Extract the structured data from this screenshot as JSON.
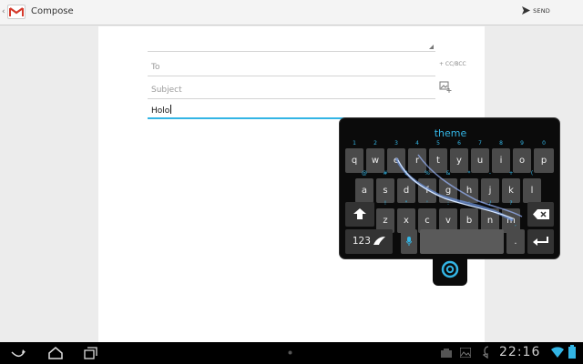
{
  "app": {
    "title": "Compose",
    "send_label": "SEND",
    "accent": "#33b5e5",
    "back_glyph": "‹"
  },
  "form": {
    "to_placeholder": "To",
    "cc_bcc_label": "+ CC/BCC",
    "subject_placeholder": "Subject",
    "body_value": "Holo"
  },
  "keyboard": {
    "theme_label": "theme",
    "row1": [
      "q",
      "w",
      "e",
      "r",
      "t",
      "y",
      "u",
      "i",
      "o",
      "p"
    ],
    "row1_hints": [
      "1",
      "2",
      "3",
      "4",
      "5",
      "6",
      "7",
      "8",
      "9",
      "0"
    ],
    "row2": [
      "a",
      "s",
      "d",
      "f",
      "g",
      "h",
      "j",
      "k",
      "l"
    ],
    "row2_hints": [
      "@",
      "#",
      "$",
      "%",
      "&",
      "*",
      "-",
      "+",
      "("
    ],
    "row3": [
      "z",
      "x",
      "c",
      "v",
      "b",
      "n",
      "m"
    ],
    "row3_hints": [
      "!",
      "\"",
      "'",
      ":",
      ";",
      "/",
      "?"
    ],
    "numbers_label": "123",
    "period_label": ".",
    "comma_hint": ",",
    "mic_icon": "microphone-icon",
    "shift_icon": "shift-icon",
    "backspace_icon": "backspace-icon",
    "enter_icon": "enter-icon"
  },
  "system": {
    "clock": "22:16",
    "nav_icons": [
      "back-icon",
      "home-icon",
      "recent-apps-icon"
    ],
    "status_icons": [
      "app-icon",
      "image-icon",
      "sync-icon",
      "wifi-icon",
      "battery-icon"
    ]
  }
}
